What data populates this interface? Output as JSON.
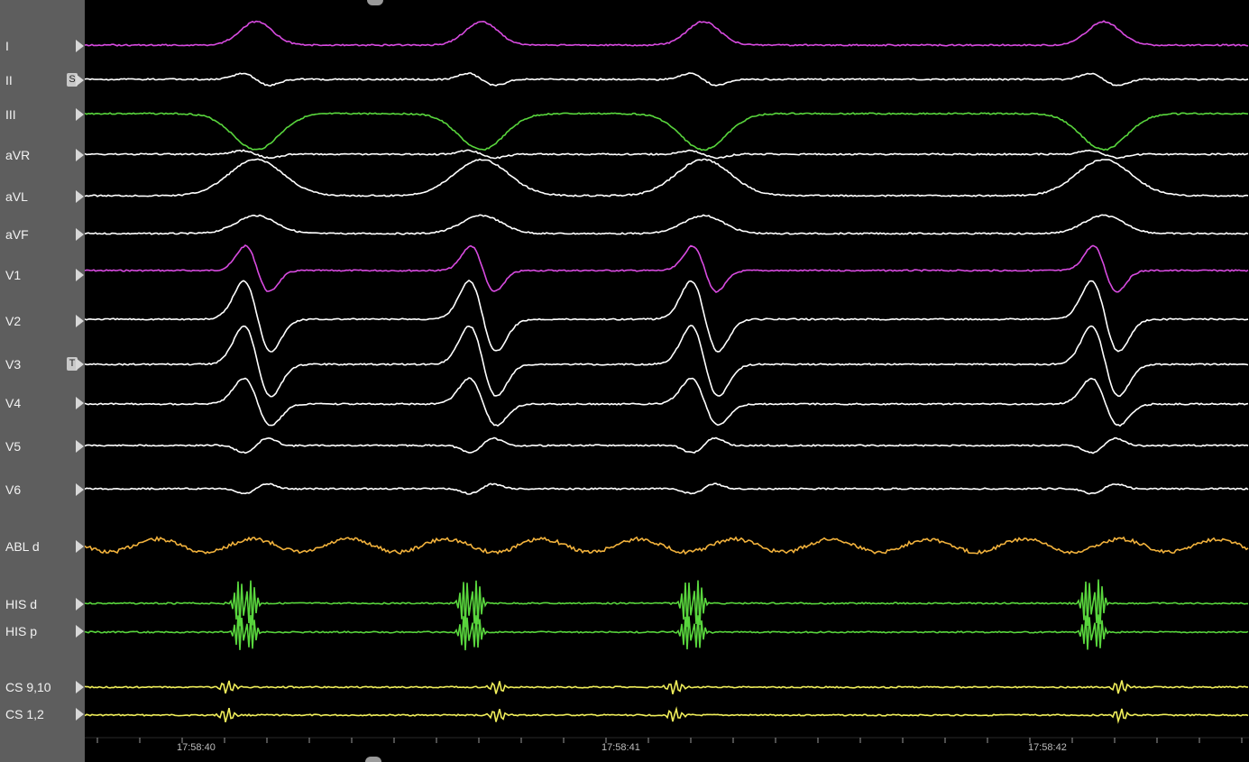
{
  "channels": [
    {
      "label": "I",
      "color": "#d84be0"
    },
    {
      "label": "II",
      "color": "#ffffff",
      "tag": "S"
    },
    {
      "label": "III",
      "color": "#59d63d"
    },
    {
      "label": "aVR",
      "color": "#ffffff"
    },
    {
      "label": "aVL",
      "color": "#ffffff"
    },
    {
      "label": "aVF",
      "color": "#ffffff"
    },
    {
      "label": "V1",
      "color": "#d84be0"
    },
    {
      "label": "V2",
      "color": "#ffffff"
    },
    {
      "label": "V3",
      "color": "#ffffff",
      "tag": "T"
    },
    {
      "label": "V4",
      "color": "#ffffff"
    },
    {
      "label": "V5",
      "color": "#ffffff"
    },
    {
      "label": "V6",
      "color": "#ffffff"
    },
    {
      "label": "ABL d",
      "color": "#f2b23c"
    },
    {
      "label": "HIS d",
      "color": "#59d63d"
    },
    {
      "label": "HIS p",
      "color": "#59d63d"
    },
    {
      "label": "CS 9,10",
      "color": "#f0ee5a"
    },
    {
      "label": "CS 1,2",
      "color": "#f0ee5a"
    }
  ],
  "time_labels": [
    "17:58:40",
    "17:58:41",
    "17:58:42"
  ],
  "colors": {
    "background": "#000000",
    "sidebar": "#5e5e5e",
    "axis": "#9a9a9a"
  },
  "icons": {
    "channel_marker": "right-triangle-icon",
    "scroll_grip": "grip-handle-icon"
  }
}
